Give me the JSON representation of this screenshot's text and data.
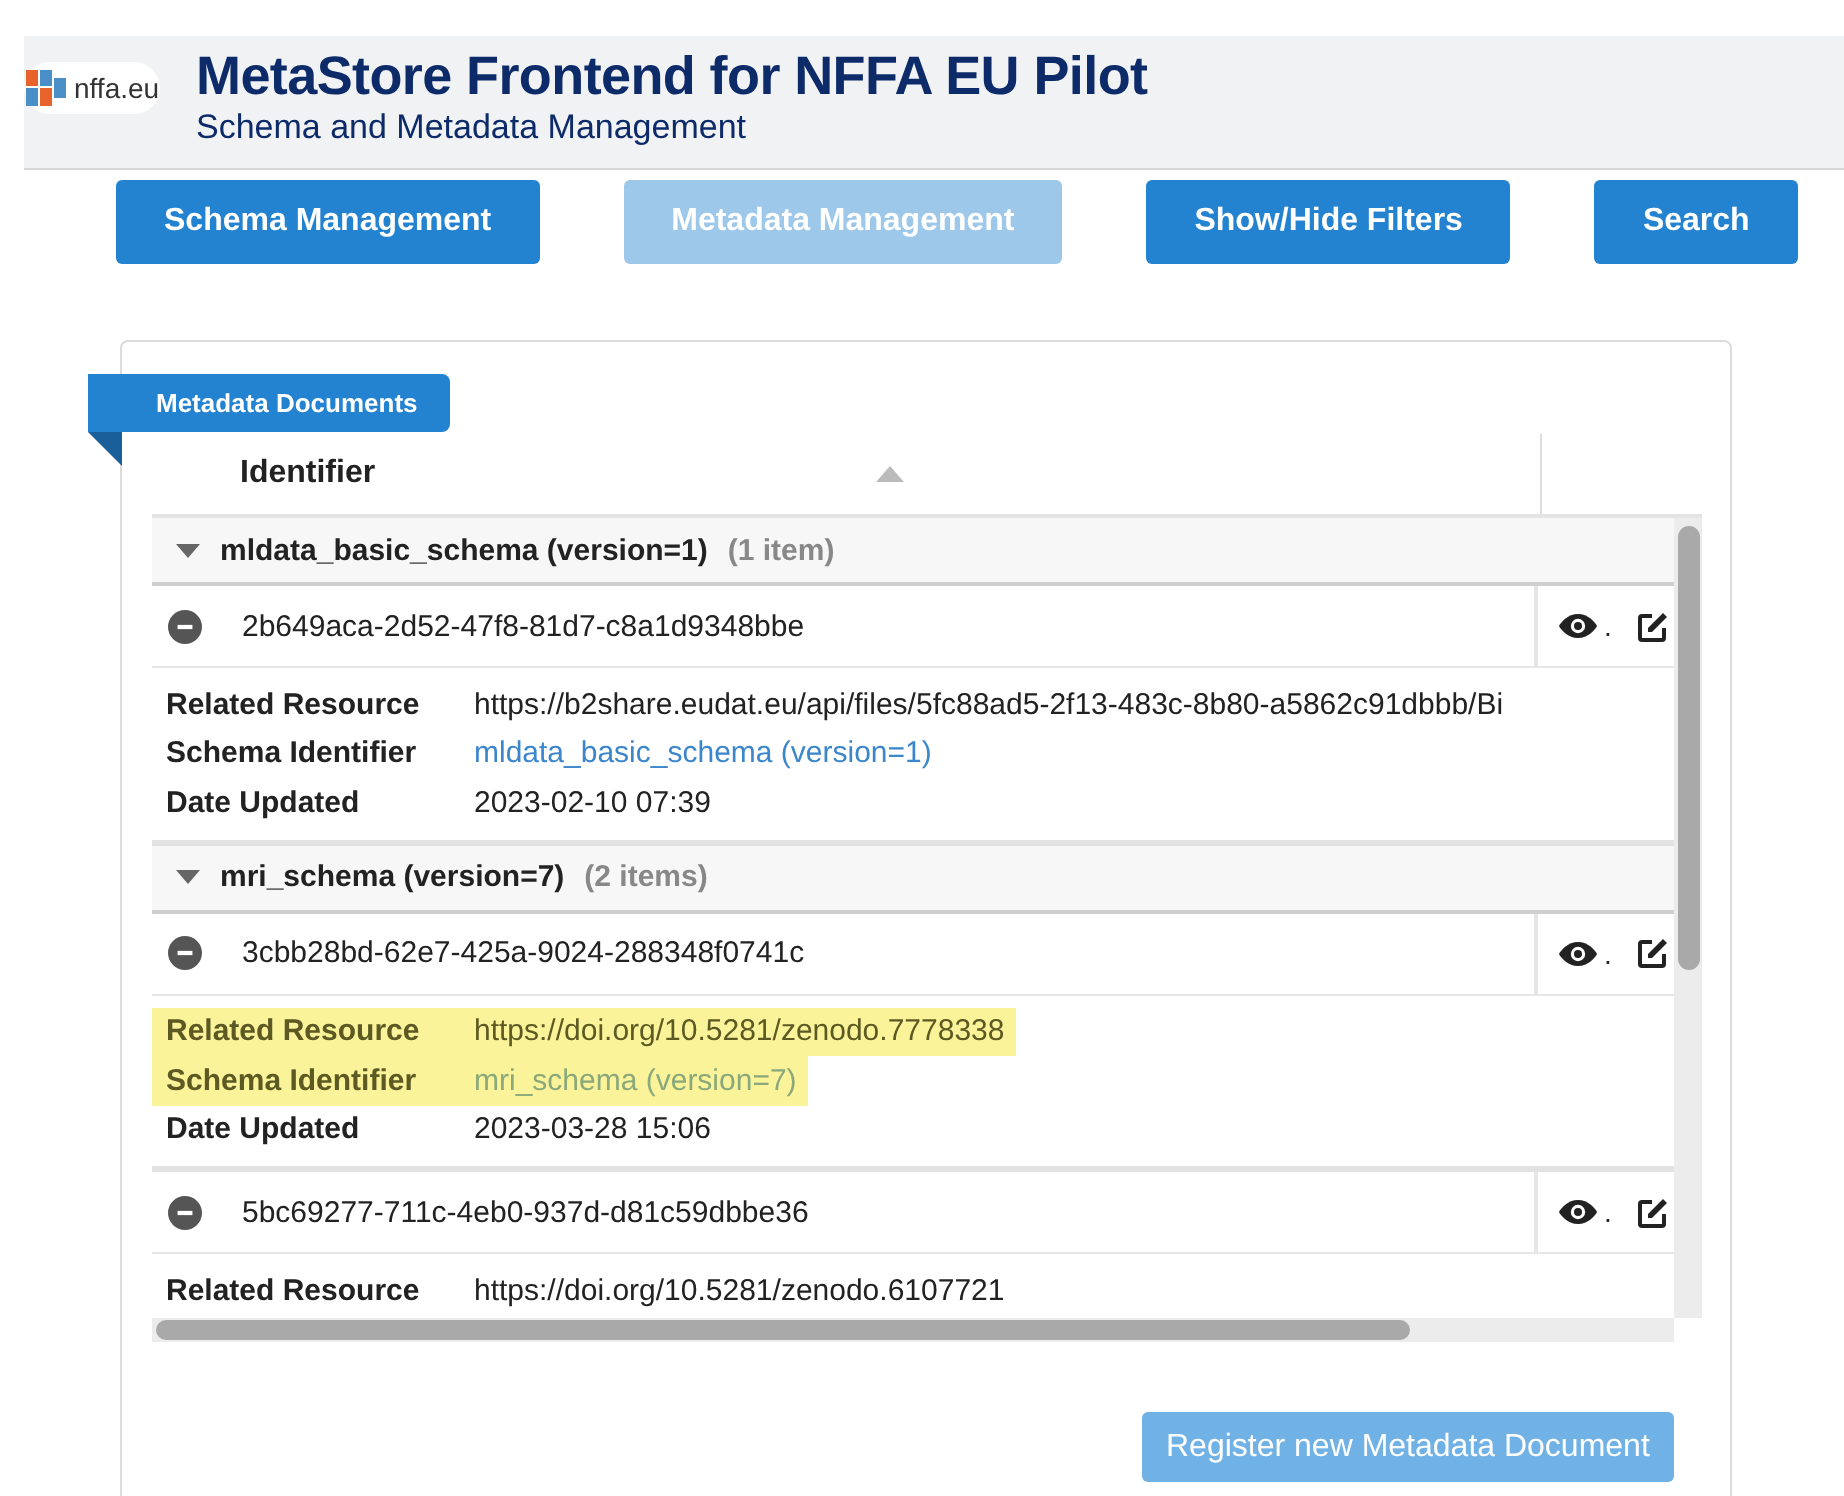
{
  "header": {
    "logo_text": "nffa.eu",
    "title": "MetaStore Frontend for NFFA EU Pilot",
    "subtitle": "Schema and Metadata Management"
  },
  "nav_buttons": [
    {
      "label": "Schema Management",
      "disabled": false
    },
    {
      "label": "Metadata Management",
      "disabled": true
    },
    {
      "label": "Show/Hide Filters",
      "disabled": false
    },
    {
      "label": "Search",
      "disabled": false
    }
  ],
  "panel": {
    "tab_label": "Metadata Documents",
    "table": {
      "columns": [
        {
          "label": "Identifier"
        }
      ],
      "groups": [
        {
          "title": "mldata_basic_schema (version=1)",
          "count": "(1 item)",
          "expanded": true,
          "rows": [
            {
              "identifier": "2b649aca-2d52-47f8-81d7-c8a1d9348bbe",
              "separator": ".",
              "details": [
                {
                  "label": "Related Resource",
                  "value": "https://b2share.eudat.eu/api/files/5fc88ad5-2f13-483c-8b80-a5862c91dbbb/Bi",
                  "kind": "text",
                  "highlighted": false
                },
                {
                  "label": "Schema Identifier",
                  "value": "mldata_basic_schema (version=1)",
                  "kind": "link",
                  "highlighted": false
                },
                {
                  "label": "Date Updated",
                  "value": "2023-02-10 07:39",
                  "kind": "text",
                  "highlighted": false
                }
              ]
            }
          ]
        },
        {
          "title": "mri_schema (version=7)",
          "count": "(2 items)",
          "expanded": true,
          "rows": [
            {
              "identifier": "3cbb28bd-62e7-425a-9024-288348f0741c",
              "separator": ".",
              "details": [
                {
                  "label": "Related Resource",
                  "value": "https://doi.org/10.5281/zenodo.7778338",
                  "kind": "text",
                  "highlighted": true
                },
                {
                  "label": "Schema Identifier",
                  "value": "mri_schema (version=7)",
                  "kind": "link",
                  "highlighted": true
                },
                {
                  "label": "Date Updated",
                  "value": "2023-03-28 15:06",
                  "kind": "text",
                  "highlighted": false
                }
              ]
            },
            {
              "identifier": "5bc69277-711c-4eb0-937d-d81c59dbbe36",
              "separator": ".",
              "details": [
                {
                  "label": "Related Resource",
                  "value": "https://doi.org/10.5281/zenodo.6107721",
                  "kind": "text",
                  "highlighted": false
                }
              ]
            }
          ]
        }
      ]
    },
    "register_button": {
      "label": "Register new Metadata Document",
      "disabled": true
    }
  }
}
